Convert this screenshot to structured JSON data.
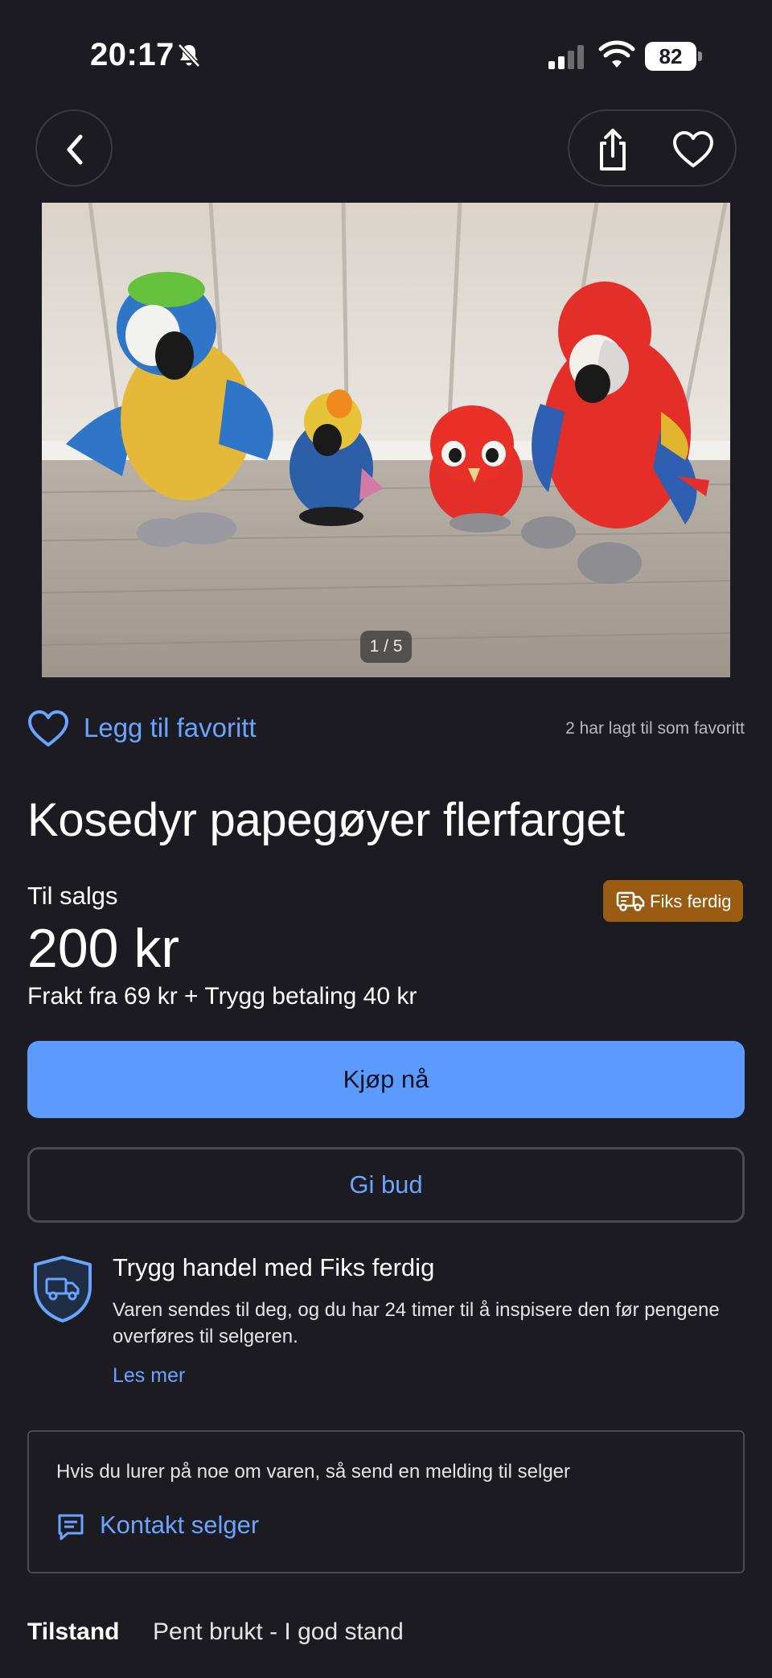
{
  "status_bar": {
    "time": "20:17",
    "battery": "82",
    "icons": [
      "bell-slash-icon",
      "signal-icon",
      "wifi-icon",
      "battery-icon"
    ]
  },
  "nav": {
    "back_icon": "chevron-left-icon",
    "share_icon": "share-icon",
    "favorite_icon": "heart-icon"
  },
  "image": {
    "counter": "1 / 5"
  },
  "favorite": {
    "label": "Legg til favoritt",
    "count_text": "2 har lagt til som favoritt"
  },
  "listing": {
    "title": "Kosedyr papegøyer flerfarget",
    "sale_label": "Til salgs",
    "price": "200 kr",
    "shipping": "Frakt fra 69 kr + Trygg betaling 40 kr",
    "badge": "Fiks ferdig"
  },
  "actions": {
    "buy": "Kjøp nå",
    "bid": "Gi bud"
  },
  "safe_trade": {
    "title": "Trygg handel med Fiks ferdig",
    "text": "Varen sendes til deg, og du har 24 timer til å inspisere den før pengene overføres til selgeren.",
    "link": "Les mer"
  },
  "contact": {
    "text": "Hvis du lurer på noe om varen, så send en melding til selger",
    "button": "Kontakt selger"
  },
  "condition": {
    "label": "Tilstand",
    "value": "Pent brukt - I god stand"
  },
  "colors": {
    "background": "#1c1b21",
    "accent": "#5b9bff",
    "link": "#6aa4ff",
    "badge": "#9a5b12"
  }
}
